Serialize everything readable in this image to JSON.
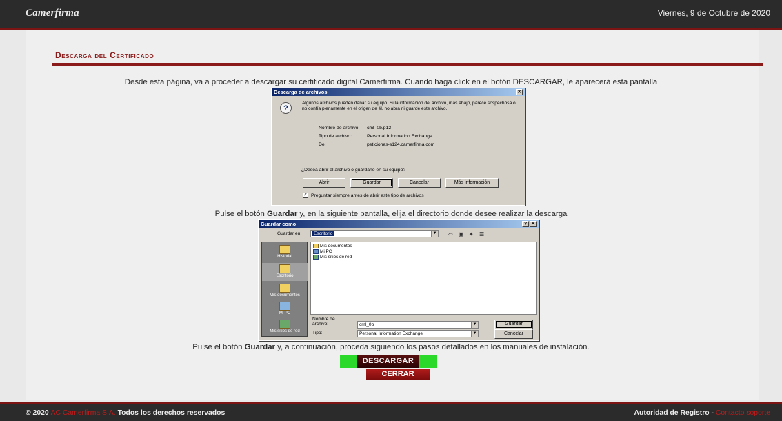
{
  "header": {
    "logo": "Camerfirma",
    "date": "Viernes, 9 de Octubre de 2020"
  },
  "main": {
    "title": "Descarga del Certificado",
    "intro": "Desde esta página, va a proceder a descargar su certificado digital Camerfirma. Cuando haga click en el botón DESCARGAR, le aparecerá esta pantalla",
    "step2_pre": "Pulse el botón ",
    "step2_bold": "Guardar",
    "step2_post": " y, en la siguiente pantalla, elija el directorio donde desee realizar la descarga",
    "step3_pre": "Pulse el botón ",
    "step3_bold": "Guardar",
    "step3_post": " y, a continuación, proceda siguiendo los pasos detallados en los manuales de instalación.",
    "download_button": "DESCARGAR",
    "close_button": "CERRAR"
  },
  "download_dialog": {
    "title": "Descarga de archivos",
    "warning": "Algunos archivos pueden dañar su equipo. Si la información del archivo, más abajo, parece sospechosa o no confía plenamente en el origen de él, no abra ni guarde este archivo.",
    "name_label": "Nombre de archivo:",
    "name_value": "cml_0b.p12",
    "type_label": "Tipo de archivo:",
    "type_value": "Personal Information Exchange",
    "from_label": "De:",
    "from_value": "peticiones-s124.camerfirma.com",
    "question": "¿Desea abrir el archivo o guardarlo en su equipo?",
    "btn_open": "Abrir",
    "btn_save": "Guardar",
    "btn_cancel": "Cancelar",
    "btn_more": "Más información",
    "checkbox": "Preguntar siempre antes de abrir este tipo de archivos"
  },
  "save_dialog": {
    "title": "Guardar como",
    "help": "?",
    "save_in_label": "Guardar en:",
    "save_in_value": "Escritorio",
    "places": [
      "Historial",
      "Escritorio",
      "Mis documentos",
      "Mi PC",
      "Mis sitios de red"
    ],
    "files": [
      "Mis documentos",
      "Mi PC",
      "Mis sitios de red"
    ],
    "filename_label": "Nombre de archivo:",
    "filename_value": "cml_0b",
    "type_label": "Tipo:",
    "type_value": "Personal Information Exchange",
    "btn_save": "Guardar",
    "btn_cancel": "Cancelar"
  },
  "footer": {
    "copyright": "© 2020",
    "company": "AC Camerfirma S.A.",
    "rights": "Todos los derechos reservados",
    "authority": "Autoridad de Registro -",
    "contact": "Contacto soporte"
  },
  "colors": {
    "accent_red": "#8b1a1a",
    "bar_dark": "#2b2b2b",
    "download_green": "#2ad92a"
  }
}
